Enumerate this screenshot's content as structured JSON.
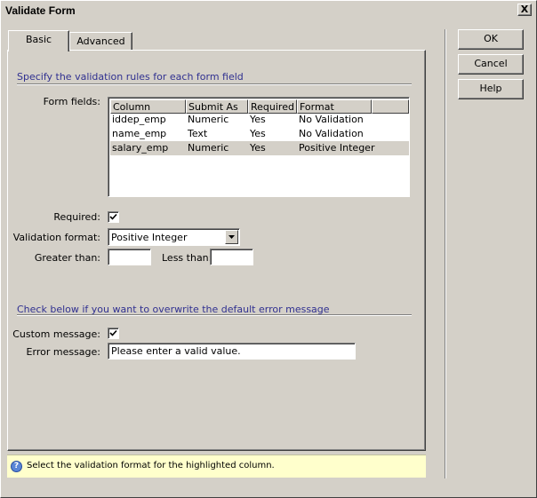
{
  "window": {
    "title": "Validate Form",
    "close_label": "X"
  },
  "tabs": [
    {
      "label": "Basic",
      "active": true
    },
    {
      "label": "Advanced",
      "active": false
    }
  ],
  "section1": {
    "title": "Specify the validation rules for each form field"
  },
  "form_fields": {
    "label": "Form fields:",
    "columns": [
      "Column",
      "Submit As",
      "Required",
      "Format"
    ],
    "rows": [
      {
        "column": "iddep_emp",
        "submit_as": "Numeric",
        "required": "Yes",
        "format": "No Validation",
        "selected": false
      },
      {
        "column": "name_emp",
        "submit_as": "Text",
        "required": "Yes",
        "format": "No Validation",
        "selected": false
      },
      {
        "column": "salary_emp",
        "submit_as": "Numeric",
        "required": "Yes",
        "format": "Positive Integer",
        "selected": true
      }
    ]
  },
  "required": {
    "label": "Required:",
    "checked": true
  },
  "validation_format": {
    "label": "Validation format:",
    "value": "Positive Integer"
  },
  "greater_than": {
    "label": "Greater than:",
    "value": ""
  },
  "less_than": {
    "label": "Less than:",
    "value": ""
  },
  "section2": {
    "title": "Check below if you want to overwrite the default error message"
  },
  "custom_message": {
    "label": "Custom message:",
    "checked": true
  },
  "error_message": {
    "label": "Error message:",
    "value": "Please enter a valid value."
  },
  "hint": {
    "icon": "help-icon",
    "text": "Select the validation format for the highlighted column."
  },
  "buttons": {
    "ok": "OK",
    "cancel": "Cancel",
    "help": "Help"
  },
  "colors": {
    "section_title": "#303090",
    "hint_bg": "#ffffcc",
    "dialog_bg": "#d4d0c8"
  }
}
